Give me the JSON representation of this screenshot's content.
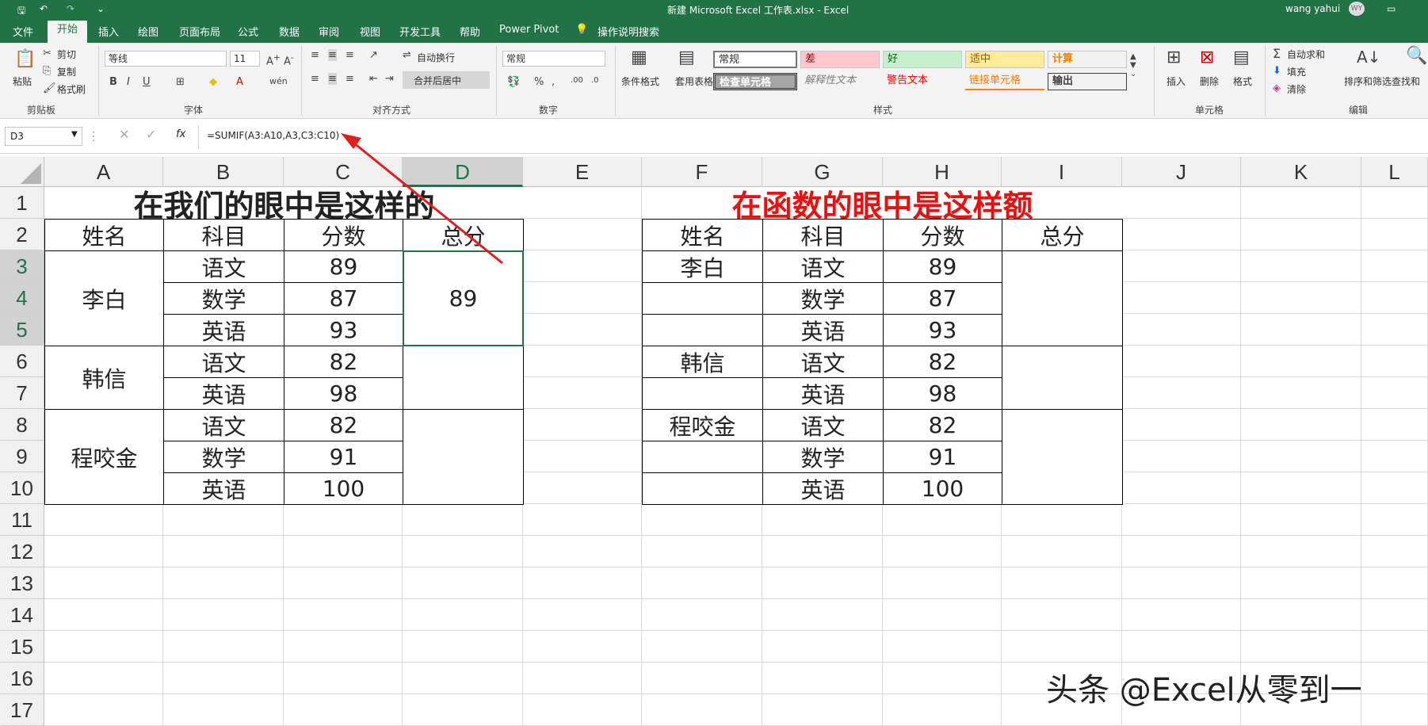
{
  "title": {
    "filename": "新建 Microsoft Excel 工作表.xlsx  -  Excel",
    "user": "wang yahui",
    "avatar": "WY"
  },
  "tabs": [
    "文件",
    "开始",
    "插入",
    "绘图",
    "页面布局",
    "公式",
    "数据",
    "审阅",
    "视图",
    "开发工具",
    "帮助",
    "Power Pivot",
    "操作说明搜索"
  ],
  "ribbon": {
    "clipboard": {
      "paste": "粘贴",
      "cut": "剪切",
      "copy": "复制",
      "format_painter": "格式刷",
      "label": "剪贴板"
    },
    "font": {
      "name": "等线",
      "size": "11",
      "label": "字体"
    },
    "alignment": {
      "wrap": "自动换行",
      "merge": "合并后居中",
      "label": "对齐方式"
    },
    "number": {
      "format": "常规",
      "label": "数字"
    },
    "styles": {
      "cond": "条件格式",
      "table": "套用表格格式",
      "normal": "常规",
      "bad": "差",
      "good": "好",
      "neutral": "适中",
      "calc": "计算",
      "check": "检查单元格",
      "explain": "解释性文本",
      "warn": "警告文本",
      "link": "链接单元格",
      "output": "输出",
      "label": "样式"
    },
    "cells": {
      "insert": "插入",
      "delete": "删除",
      "format": "格式",
      "label": "单元格"
    },
    "editing": {
      "autosum": "自动求和",
      "fill": "填充",
      "clear": "清除",
      "sort": "排序和筛选",
      "find": "查找和",
      "label": "编辑"
    }
  },
  "formula_bar": {
    "name_box": "D3",
    "formula": "=SUMIF(A3:A10,A3,C3:C10)",
    "fx": "fx"
  },
  "columns": [
    "A",
    "B",
    "C",
    "D",
    "E",
    "F",
    "G",
    "H",
    "I",
    "J",
    "K",
    "L"
  ],
  "rows": [
    "1",
    "2",
    "3",
    "4",
    "5",
    "6",
    "7",
    "8",
    "9",
    "10",
    "11",
    "12",
    "13",
    "14",
    "15",
    "16",
    "17"
  ],
  "left_table": {
    "title": "在我们的眼中是这样的",
    "headers": [
      "姓名",
      "科目",
      "分数",
      "总分"
    ],
    "names": [
      "李白",
      "韩信",
      "程咬金"
    ],
    "subjects": [
      "语文",
      "数学",
      "英语",
      "语文",
      "英语",
      "语文",
      "数学",
      "英语"
    ],
    "scores": [
      "89",
      "87",
      "93",
      "82",
      "98",
      "82",
      "91",
      "100"
    ],
    "total": "89"
  },
  "right_table": {
    "title": "在函数的眼中是这样额",
    "headers": [
      "姓名",
      "科目",
      "分数",
      "总分"
    ],
    "names": [
      "李白",
      "韩信",
      "程咬金"
    ],
    "subjects": [
      "语文",
      "数学",
      "英语",
      "语文",
      "英语",
      "语文",
      "数学",
      "英语"
    ],
    "scores": [
      "89",
      "87",
      "93",
      "82",
      "98",
      "82",
      "91",
      "100"
    ]
  },
  "watermark": "头条 @Excel从零到一",
  "colors": {
    "excel_green": "#217346",
    "arrow": "#e02020",
    "title_red": "#e81010"
  }
}
